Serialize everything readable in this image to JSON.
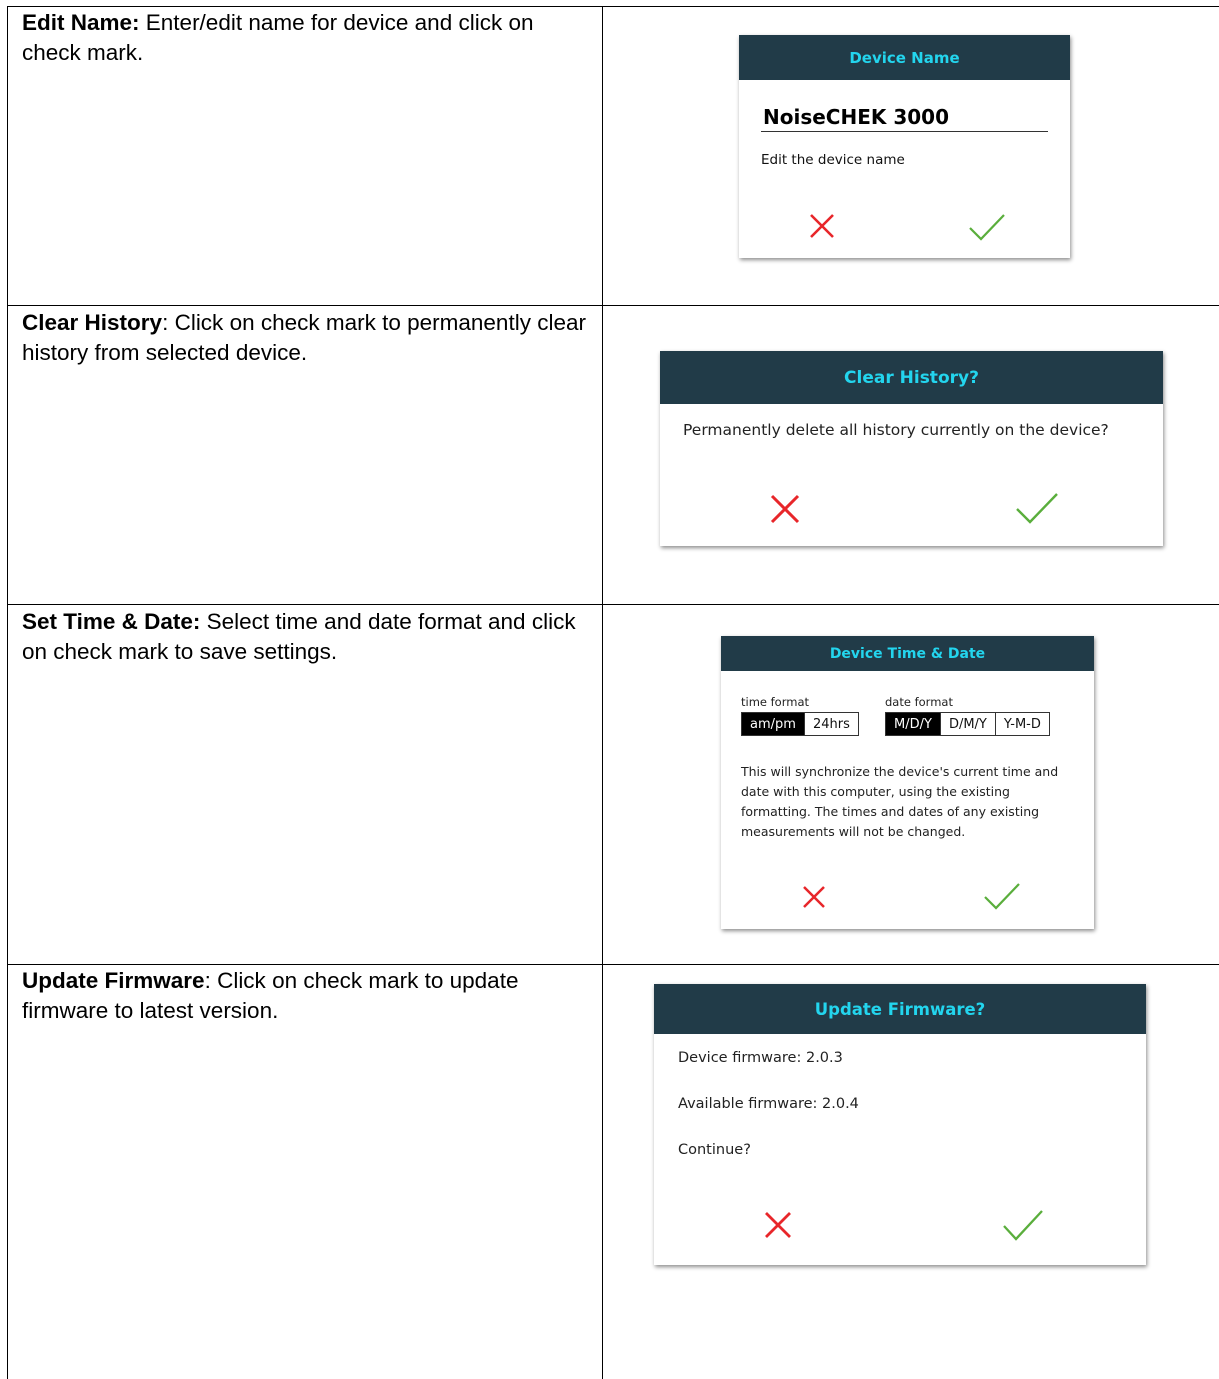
{
  "rows": [
    {
      "title": "Edit Name:",
      "text": " Enter/edit name for device and click on check mark.",
      "dialog": {
        "header": "Device Name",
        "name_value": "NoiseCHEK 3000",
        "hint": "Edit the device name",
        "cancel_icon": "x-icon",
        "confirm_icon": "check-icon"
      }
    },
    {
      "title": "Clear History",
      "text": ": Click on check mark to permanently clear history from selected device.",
      "dialog": {
        "header": "Clear History?",
        "message": "Permanently delete all history currently on the device?",
        "cancel_icon": "x-icon",
        "confirm_icon": "check-icon"
      }
    },
    {
      "title": "Set Time & Date:",
      "text": " Select time and date format and click on check mark to save settings.",
      "dialog": {
        "header": "Device Time & Date",
        "time_format_label": "time format",
        "time_options": [
          "am/pm",
          "24hrs"
        ],
        "time_selected": "am/pm",
        "date_format_label": "date format",
        "date_options": [
          "M/D/Y",
          "D/M/Y",
          "Y-M-D"
        ],
        "date_selected": "M/D/Y",
        "message": "This will synchronize the device's current time and date with this computer, using the existing formatting. The times and dates of any existing measurements will not be changed.",
        "cancel_icon": "x-icon",
        "confirm_icon": "check-icon"
      }
    },
    {
      "title": "Update Firmware",
      "text": ": Click on check mark to update firmware to latest version.",
      "dialog": {
        "header": "Update Firmware?",
        "device_firmware": "Device firmware: 2.0.3",
        "available_firmware": "Available firmware: 2.0.4",
        "continue": "Continue?",
        "cancel_icon": "x-icon",
        "confirm_icon": "check-icon"
      }
    }
  ],
  "colors": {
    "header_bg": "#213b48",
    "header_text": "#23d5ee",
    "cancel": "#e8262a",
    "confirm": "#5aae3c"
  }
}
